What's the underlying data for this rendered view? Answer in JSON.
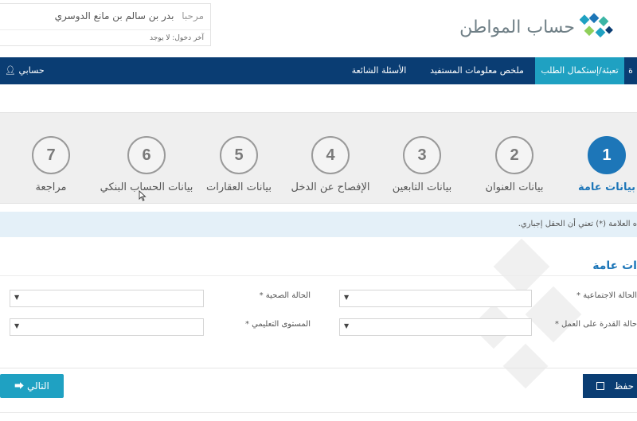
{
  "header": {
    "logo_text": "حساب المواطن",
    "welcome_label": "مرحبا",
    "user_name": "بدر بن سالم بن مانع الدوسري",
    "last_login": "آخر دخول: لا يوجد"
  },
  "navbar": {
    "items": [
      {
        "label": "ة"
      },
      {
        "label": "تعبئة/إستكمال الطلب"
      },
      {
        "label": "ملخص معلومات المستفيد"
      },
      {
        "label": "الأسئلة الشائعة"
      }
    ],
    "account_label": "حسابي"
  },
  "steps": [
    {
      "number": "1",
      "label": "بيانات عامة"
    },
    {
      "number": "2",
      "label": "بيانات العنوان"
    },
    {
      "number": "3",
      "label": "بيانات التابعين"
    },
    {
      "number": "4",
      "label": "الإفصاح عن الدخل"
    },
    {
      "number": "5",
      "label": "بيانات العقارات"
    },
    {
      "number": "6",
      "label": "بيانات الحساب البنكي"
    },
    {
      "number": "7",
      "label": "مراجعة"
    }
  ],
  "notice": "ه العلامة (*) تعني أن الحقل إجباري.",
  "section": {
    "title": "ات عامة"
  },
  "form": {
    "marital_status_label": "الحالة الاجتماعية *",
    "health_status_label": "الحالة الصحية *",
    "work_ability_label": "حالة القدرة على العمل *",
    "education_level_label": "المستوى التعليمي *"
  },
  "buttons": {
    "next_label": "التالي",
    "save_label": "حفظ"
  },
  "colors": {
    "navbar": "#0a3d73",
    "active_tab": "#1fa1c2",
    "active_step": "#1d76b8",
    "notice_bg": "#e4f0f8"
  }
}
